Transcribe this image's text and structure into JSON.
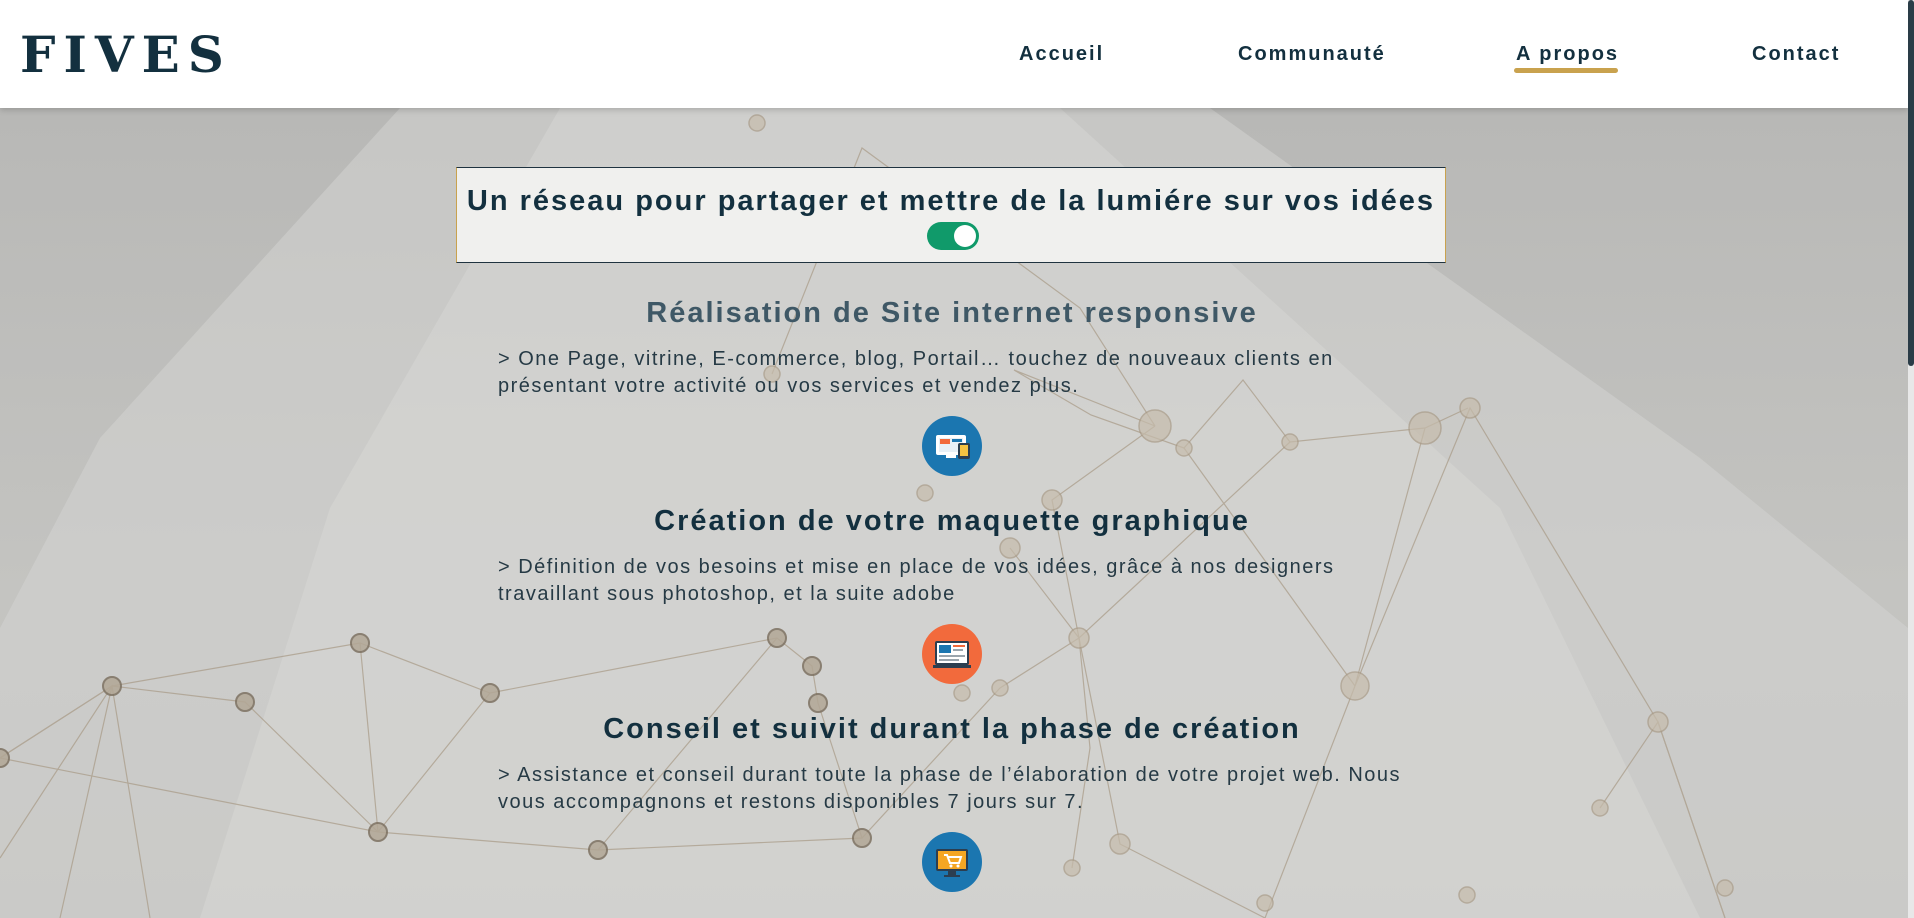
{
  "brand": {
    "logo": "FIVES"
  },
  "nav": {
    "items": [
      "Accueil",
      "Communauté",
      "A propos",
      "Contact"
    ],
    "active": "A propos",
    "accent": "#c9a24e"
  },
  "banner": {
    "title": "Un réseau pour partager et mettre de la lumiére sur vos idées",
    "toggle_on": true,
    "toggle_color": "#109a6a"
  },
  "services": [
    {
      "title": "Réalisation de Site internet responsive",
      "text": "> One Page, vitrine, E-commerce, blog, Portail… touchez de nouveaux clients en présentant votre activité ou vos services et vendez plus.",
      "icon": "responsive-devices-icon",
      "icon_color": "#1b76b0"
    },
    {
      "title": "Création de votre maquette graphique",
      "text": "> Définition de vos besoins et mise en place de vos idées, grâce à nos designers travaillant sous photoshop, et la suite adobe",
      "icon": "graphic-mockup-icon",
      "icon_color": "#f26a3c"
    },
    {
      "title": "Conseil et suivit durant la phase de création",
      "text": "> Assistance et conseil durant toute la phase de l’élaboration de votre projet web. Nous vous accompagnons et restons disponibles 7 jours sur 7.",
      "icon": "ecommerce-monitor-icon",
      "icon_color": "#1b76b0"
    }
  ]
}
